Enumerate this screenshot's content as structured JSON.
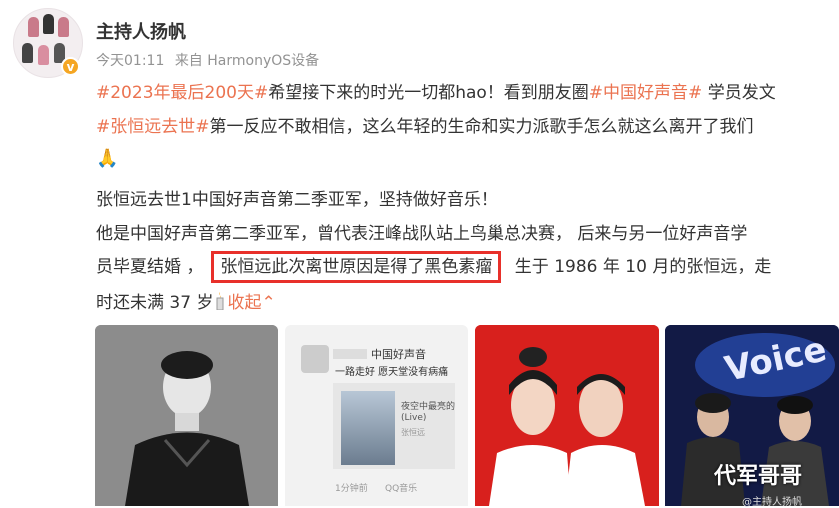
{
  "post": {
    "author": "主持人扬帆",
    "time": "今天01:11",
    "source": "来自 HarmonyOS设备",
    "lines": {
      "l1_tag1": "#2023年最后200天#",
      "l1_text1": "希望接下来的时光一切都hao！看到朋友圈",
      "l1_tag2": "#中国好声音#",
      "l1_text2": " 学员发文",
      "l2_tag": "#张恒远去世#",
      "l2_text": "第一反应不敢相信，这么年轻的生命和实力派歌手怎么就这么离开了我们",
      "l3_emoji": "🙏",
      "l4_text": "张恒远去世1中国好声音第二季亚军，坚持做好音乐！",
      "l5_text": "他是中国好声音第二季亚军，曾代表汪峰战队站上鸟巢总决赛， 后来与另一位好声音学",
      "l6_pre": "员毕夏结婚 ，",
      "l6_highlight": "张恒远此次离世原因是得了黑色素瘤",
      "l6_post": " 生于 1986 年 10 月的张恒远，走",
      "l7_text": "时还未满 37 岁",
      "l7_collapse": "收起"
    }
  },
  "images": {
    "img2": {
      "title": "中国好声音",
      "subtitle": "一路走好 愿天堂没有病痛",
      "song": "夜空中最亮的",
      "song2": "(Live)",
      "singer": "张恒远",
      "time": "1分钟前",
      "app": "QQ音乐"
    },
    "img4": {
      "banner": "Voice",
      "watermark": "代军哥哥",
      "credit": "@主持人扬帆"
    }
  },
  "colors": {
    "tag": "#eb7350",
    "highlight_border": "#e8302a",
    "verify": "#f5a623"
  }
}
